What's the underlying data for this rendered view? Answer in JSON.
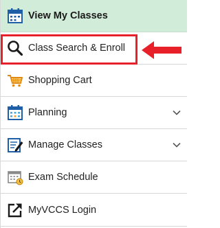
{
  "menu": {
    "items": [
      {
        "label": "View My Classes",
        "icon": "calendar-icon",
        "active": true,
        "expandable": false
      },
      {
        "label": "Class Search & Enroll",
        "icon": "search-icon",
        "active": false,
        "expandable": false
      },
      {
        "label": "Shopping Cart",
        "icon": "shopping-cart-icon",
        "active": false,
        "expandable": false
      },
      {
        "label": "Planning",
        "icon": "planning-calendar-icon",
        "active": false,
        "expandable": true
      },
      {
        "label": "Manage Classes",
        "icon": "edit-document-icon",
        "active": false,
        "expandable": true
      },
      {
        "label": "Exam Schedule",
        "icon": "exam-calendar-icon",
        "active": false,
        "expandable": false
      },
      {
        "label": "MyVCCS Login",
        "icon": "external-link-icon",
        "active": false,
        "expandable": false
      }
    ]
  },
  "annotation": {
    "highlight_color": "#e8202a",
    "arrow_color": "#e8202a"
  },
  "colors": {
    "active_background": "#d1ecd8",
    "icon_blue": "#1f5fa8",
    "cart_orange": "#f0a020"
  }
}
